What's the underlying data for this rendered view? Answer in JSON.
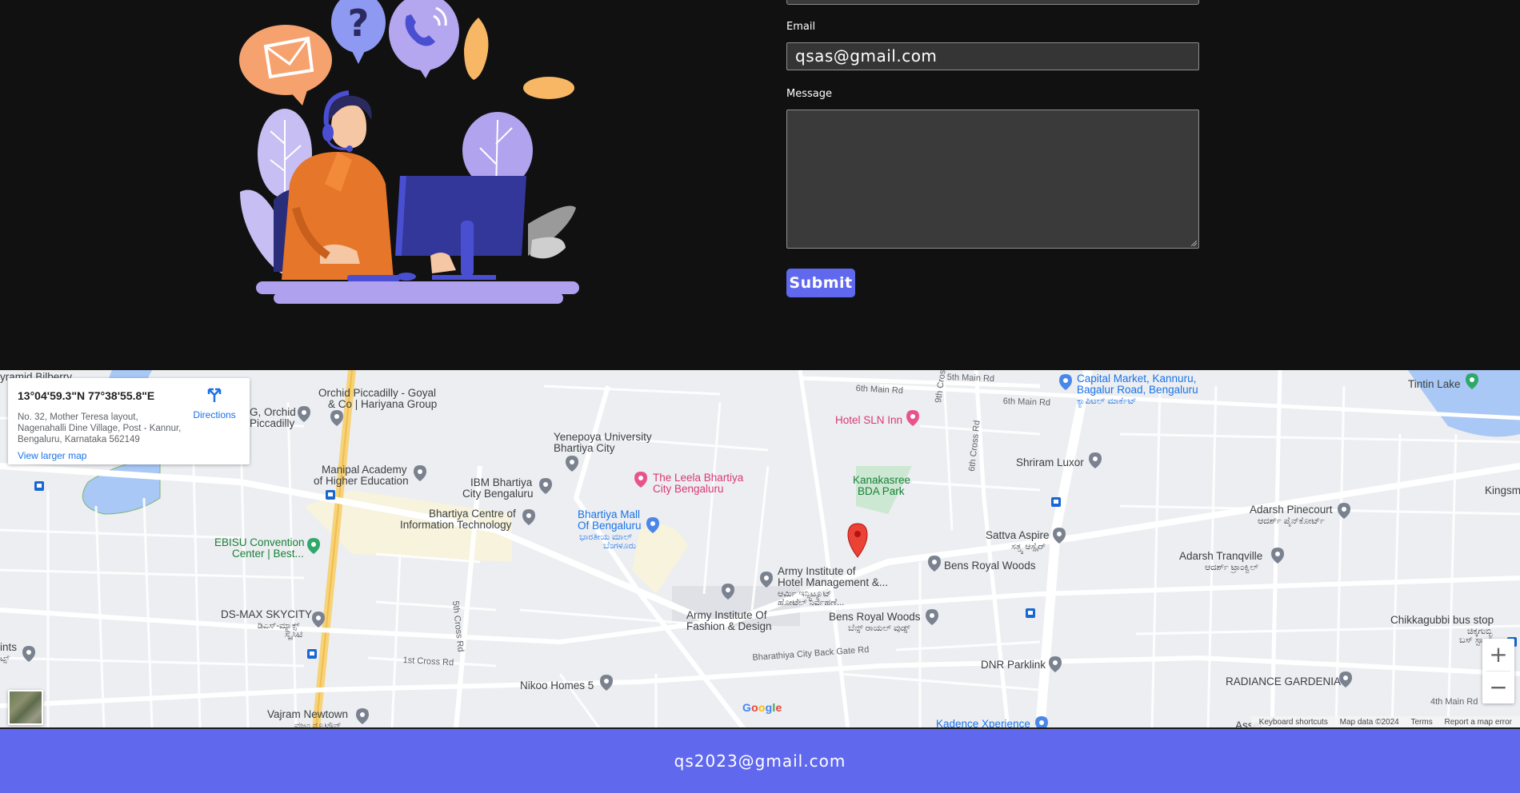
{
  "form": {
    "email_label": "Email",
    "email_value": "qsas@gmail.com",
    "message_label": "Message",
    "message_value": "",
    "submit_label": "Submit"
  },
  "map": {
    "info": {
      "coordinates": "13°04'59.3\"N 77°38'55.8\"E",
      "address": "No. 32, Mother Teresa layout, Nagenahalli Dine Village, Post - Kannur, Bengaluru, Karnataka 562149",
      "directions_label": "Directions",
      "larger_map_label": "View larger map"
    },
    "labels": {
      "pyramid": "yramid Bilberry",
      "orchid": "Orchid Piccadilly - Goyal",
      "orchid2": "& Co | Hariyana Group",
      "g_orchid": "G, Orchid",
      "piccadilly": "Piccadilly",
      "yenepoya": "Yenepoya University",
      "bhartiya_city": "Bhartiya City",
      "manipal": "Manipal Academy",
      "manipal2": "of Higher Education",
      "ibm": "IBM Bhartiya",
      "ibm2": "City Bengaluru",
      "leela": "The Leela Bhartiya",
      "leela2": "City Bengaluru",
      "hotel_sln": "Hotel SLN Inn",
      "kanakasree": "Kanakasree",
      "kanakasree2": "BDA Park",
      "bhartiya_centre": "Bhartiya Centre of",
      "bhartiya_centre2": "Information Technology",
      "mall": "Bhartiya Mall",
      "mall2": "Of Bengaluru",
      "mall_kn": "ಭಾರತೀಯ ಮಾಲ್",
      "mall_kn2": "ಬೆಂಗಳೂರು",
      "ebisu": "EBISU Convention",
      "ebisu2": "Center | Best...",
      "dsmax": "DS-MAX SKYCITY",
      "dsmax_kn": "ಡಿಎಸ್-ಮ್ಯಾಕ್ಸ್",
      "dsmax_kn2": "ಸ್ಕೈಸಿಟಿ",
      "army_hotel": "Army Institute of",
      "army_hotel2": "Hotel Management &...",
      "army_hotel_kn": "ಆರ್ಮಿ ಇನ್ಸ್ಟಿಟ್ಯೂಟ್",
      "army_hotel_kn2": "ಹೋಟೆಲ್ ನಿರ್ವಹಣೆ...",
      "army_fashion": "Army Institute Of",
      "army_fashion2": "Fashion & Design",
      "bens_woods_r": "Bens Royal Woods",
      "bens_woods": "Bens Royal Woods",
      "bens_woods_kn": "ಬೆನ್ಸ್ ರಾಯಲ್ ವುಡ್ಸ್",
      "bharathiya_gate": "Bharathiya City Back Gate Rd",
      "first_cross": "1st Cross Rd",
      "fifth_cross": "5th Cross Rd",
      "sixth_main": "6th Main Rd",
      "sixth_main2": "6th Main Rd",
      "fifth_main": "5th Main Rd",
      "ninth_cross": "9th Cross Rd",
      "sixth_cross": "6th Cross Rd",
      "nikoo": "Nikoo Homes 5",
      "vajram": "Vajram Newtown",
      "vajram_kn": "ವಜ್ರಂ ನ್ಯೂಟೌನ್",
      "capital": "Capital Market, Kannuru,",
      "capital2": "Bagalur Road, Bengaluru",
      "capital_kn": "ಕ್ಯಾಪಿಟಲ್ ಮಾರ್ಕೆಟ್",
      "tintin": "Tintin Lake",
      "shriram": "Shriram Luxor",
      "sattva": "Sattva Aspire",
      "sattva_kn": "ಸತ್ತ್ವ ಆಸ್ಪೈರ್",
      "adarsh_pinecourt": "Adarsh Pinecourt",
      "adarsh_pinecourt_kn": "ಆದರ್ಶ್ ಪೈನ್‌ಕೋರ್ಟ್",
      "adarsh_tranq": "Adarsh Tranqville",
      "adarsh_tranq_kn": "ಆದರ್ಶ್ ಟ್ರಾಂಕ್ವಿಲ್",
      "kingsm": "Kingsm",
      "chikkagubbi": "Chikkagubbi bus stop",
      "chikkagubbi_kn": "ಚಿಕ್ಕಗುಬ್ಬಿ",
      "chikkagubbi_kn2": "ಬಸ್ ಸ್ಟಾಪ್",
      "dnr": "DNR Parklink",
      "radiance": "RADIANCE GARDENIA",
      "fourth_main": "4th Main Rd",
      "kadence": "Kadence Xperience",
      "asset": "Asset",
      "ints": "ints",
      "ints_kn": "ಟ್ಸ್"
    },
    "google_logo": "Google",
    "attribution": {
      "shortcuts": "Keyboard shortcuts",
      "map_data": "Map data ©2024",
      "terms": "Terms",
      "report": "Report a map error"
    },
    "zoom_in": "+",
    "zoom_out": "−"
  },
  "footer": {
    "email": "qs2023@gmail.com"
  },
  "colors": {
    "accent": "#6069ee",
    "background": "#111111",
    "map_bg": "#eceef1"
  }
}
